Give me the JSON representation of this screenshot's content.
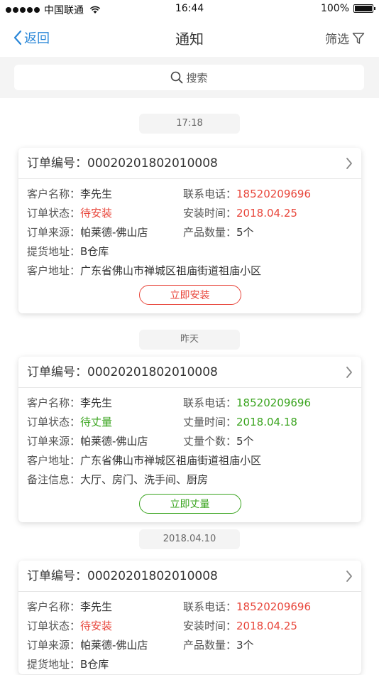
{
  "status_bar": {
    "carrier": "中国联通",
    "time": "16:44",
    "battery": "100%"
  },
  "nav": {
    "back_label": "返回",
    "title": "通知",
    "filter_label": "筛选"
  },
  "search": {
    "placeholder": "搜索"
  },
  "colors": {
    "accent_blue": "#2a87d8",
    "alert_red": "#e8463b",
    "ok_green": "#3aa41f"
  },
  "notifications": [
    {
      "timestamp": "17:18",
      "order_label": "订单编号：",
      "order_no": "00020201802010008",
      "rows": [
        {
          "l1": "客户名称：",
          "v1": "李先生",
          "l2": "联系电话：",
          "v2": "18520209696"
        },
        {
          "l1": "订单状态：",
          "v1": "待安装",
          "l2": "安装时间：",
          "v2": "2018.04.25"
        },
        {
          "l1": "订单来源：",
          "v1": "帕莱德-佛山店",
          "l2": "产品数量：",
          "v2": "5个"
        },
        {
          "l1": "提货地址：",
          "v1": "B仓库"
        },
        {
          "l1": "客户地址：",
          "v1": "广东省佛山市禅城区祖庙街道祖庙小区"
        }
      ],
      "action_label": "立即安装"
    },
    {
      "timestamp": "昨天",
      "order_label": "订单编号：",
      "order_no": "00020201802010008",
      "rows": [
        {
          "l1": "客户名称：",
          "v1": "李先生",
          "l2": "联系电话：",
          "v2": "18520209696"
        },
        {
          "l1": "订单状态：",
          "v1": "待丈量",
          "l2": "丈量时间：",
          "v2": "2018.04.18"
        },
        {
          "l1": "订单来源：",
          "v1": "帕莱德-佛山店",
          "l2": "丈量个数：",
          "v2": "5个"
        },
        {
          "l1": "客户地址：",
          "v1": "广东省佛山市禅城区祖庙街道祖庙小区"
        },
        {
          "l1": "备注信息：",
          "v1": "大厅、房门、洗手间、厨房"
        }
      ],
      "action_label": "立即丈量"
    },
    {
      "timestamp": "2018.04.10",
      "order_label": "订单编号：",
      "order_no": "00020201802010008",
      "rows": [
        {
          "l1": "客户名称：",
          "v1": "李先生",
          "l2": "联系电话：",
          "v2": "18520209696"
        },
        {
          "l1": "订单状态：",
          "v1": "待安装",
          "l2": "安装时间：",
          "v2": "2018.04.25"
        },
        {
          "l1": "订单来源：",
          "v1": "帕莱德-佛山店",
          "l2": "产品数量：",
          "v2": "3个"
        },
        {
          "l1": "提货地址：",
          "v1": "B仓库"
        }
      ]
    }
  ]
}
